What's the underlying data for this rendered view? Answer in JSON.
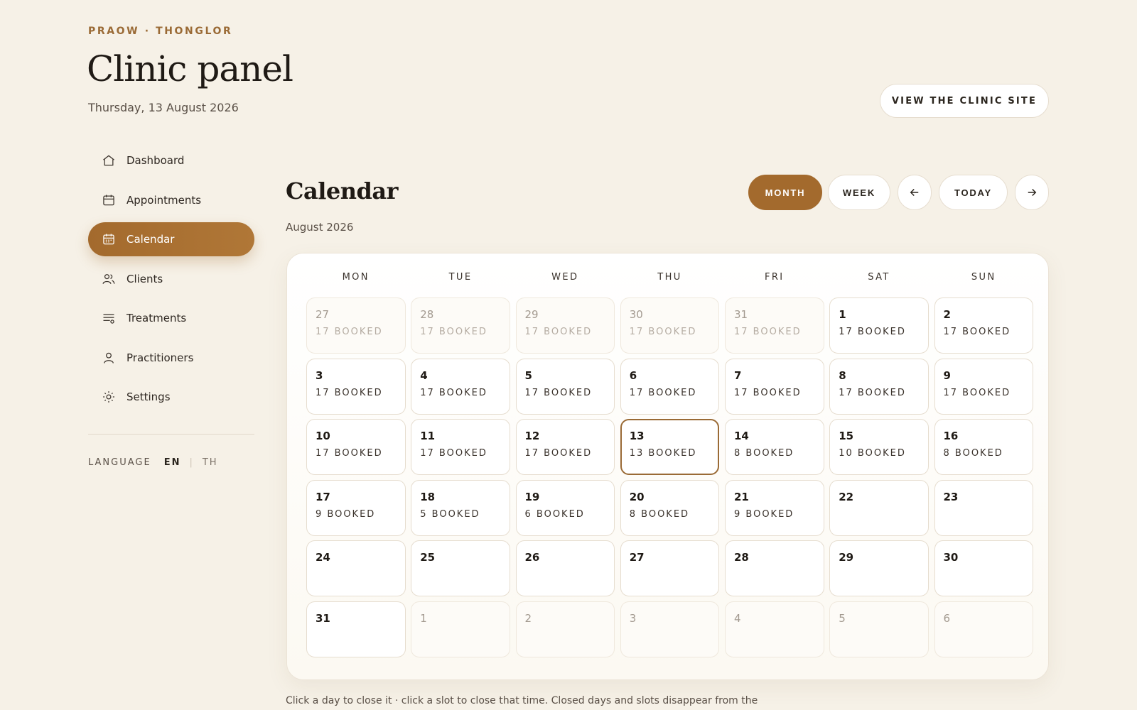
{
  "header": {
    "eyebrow": "PRAOW · THONGLOR",
    "title": "Clinic panel",
    "date": "Thursday, 13 August 2026",
    "site_button": "VIEW THE CLINIC SITE"
  },
  "sidebar": {
    "items": [
      {
        "label": "Dashboard",
        "icon": "home-icon",
        "active": false
      },
      {
        "label": "Appointments",
        "icon": "calendar-icon",
        "active": false
      },
      {
        "label": "Calendar",
        "icon": "calendar-grid-icon",
        "active": true
      },
      {
        "label": "Clients",
        "icon": "users-icon",
        "active": false
      },
      {
        "label": "Treatments",
        "icon": "list-icon",
        "active": false
      },
      {
        "label": "Practitioners",
        "icon": "user-icon",
        "active": false
      },
      {
        "label": "Settings",
        "icon": "sun-icon",
        "active": false
      }
    ],
    "language": {
      "label": "LANGUAGE",
      "options": [
        "EN",
        "TH"
      ],
      "selected": "EN"
    }
  },
  "calendar": {
    "title": "Calendar",
    "month_label": "August 2026",
    "controls": {
      "month": "MONTH",
      "week": "WEEK",
      "today": "TODAY",
      "active_view": "month"
    },
    "weekdays": [
      "MON",
      "TUE",
      "WED",
      "THU",
      "FRI",
      "SAT",
      "SUN"
    ],
    "days": [
      {
        "day": "27",
        "booked": "17 BOOKED",
        "outside": true
      },
      {
        "day": "28",
        "booked": "17 BOOKED",
        "outside": true
      },
      {
        "day": "29",
        "booked": "17 BOOKED",
        "outside": true
      },
      {
        "day": "30",
        "booked": "17 BOOKED",
        "outside": true
      },
      {
        "day": "31",
        "booked": "17 BOOKED",
        "outside": true
      },
      {
        "day": "1",
        "booked": "17 BOOKED"
      },
      {
        "day": "2",
        "booked": "17 BOOKED"
      },
      {
        "day": "3",
        "booked": "17 BOOKED"
      },
      {
        "day": "4",
        "booked": "17 BOOKED"
      },
      {
        "day": "5",
        "booked": "17 BOOKED"
      },
      {
        "day": "6",
        "booked": "17 BOOKED"
      },
      {
        "day": "7",
        "booked": "17 BOOKED"
      },
      {
        "day": "8",
        "booked": "17 BOOKED"
      },
      {
        "day": "9",
        "booked": "17 BOOKED"
      },
      {
        "day": "10",
        "booked": "17 BOOKED"
      },
      {
        "day": "11",
        "booked": "17 BOOKED"
      },
      {
        "day": "12",
        "booked": "17 BOOKED"
      },
      {
        "day": "13",
        "booked": "13 BOOKED",
        "today": true
      },
      {
        "day": "14",
        "booked": "8 BOOKED"
      },
      {
        "day": "15",
        "booked": "10 BOOKED"
      },
      {
        "day": "16",
        "booked": "8 BOOKED"
      },
      {
        "day": "17",
        "booked": "9 BOOKED"
      },
      {
        "day": "18",
        "booked": "5 BOOKED"
      },
      {
        "day": "19",
        "booked": "6 BOOKED"
      },
      {
        "day": "20",
        "booked": "8 BOOKED"
      },
      {
        "day": "21",
        "booked": "9 BOOKED"
      },
      {
        "day": "22",
        "booked": ""
      },
      {
        "day": "23",
        "booked": ""
      },
      {
        "day": "24",
        "booked": ""
      },
      {
        "day": "25",
        "booked": ""
      },
      {
        "day": "26",
        "booked": ""
      },
      {
        "day": "27",
        "booked": ""
      },
      {
        "day": "28",
        "booked": ""
      },
      {
        "day": "29",
        "booked": ""
      },
      {
        "day": "30",
        "booked": ""
      },
      {
        "day": "31",
        "booked": ""
      },
      {
        "day": "1",
        "booked": "",
        "outside": true
      },
      {
        "day": "2",
        "booked": "",
        "outside": true
      },
      {
        "day": "3",
        "booked": "",
        "outside": true
      },
      {
        "day": "4",
        "booked": "",
        "outside": true
      },
      {
        "day": "5",
        "booked": "",
        "outside": true
      },
      {
        "day": "6",
        "booked": "",
        "outside": true
      }
    ]
  },
  "footnote": "Click a day to close it · click a slot to close that time. Closed days and slots disappear from the",
  "colors": {
    "accent": "#a36a2d",
    "background": "#f6f1e7",
    "eyebrow": "#9a6a35"
  }
}
